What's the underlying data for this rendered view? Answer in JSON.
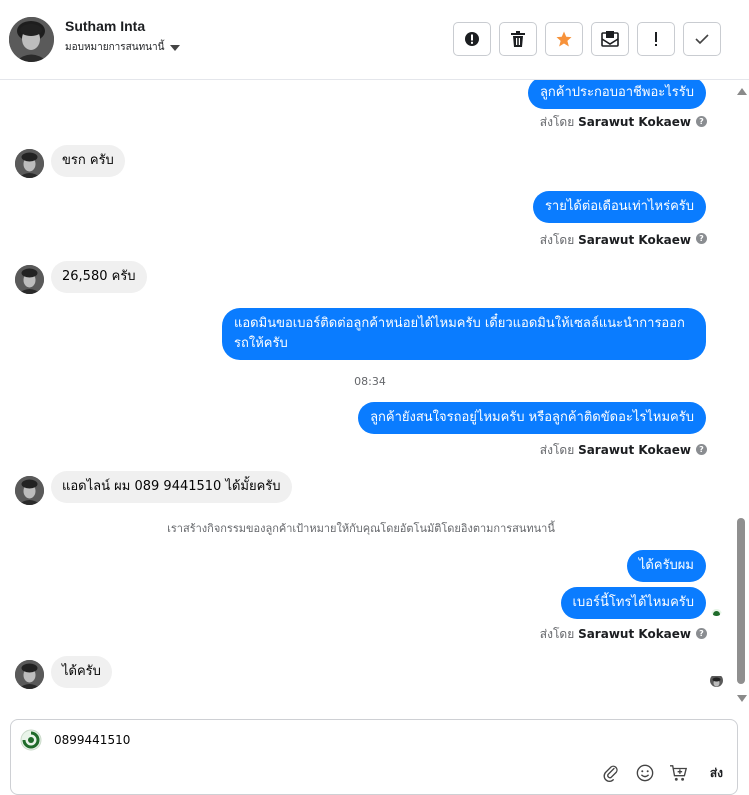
{
  "header": {
    "contact_name": "Sutham Inta",
    "assign_label": "มอบหมายการสนทนานี้",
    "toolbar": [
      {
        "icon": "alert-circle-icon",
        "label": "!"
      },
      {
        "icon": "trash-icon"
      },
      {
        "icon": "star-icon",
        "color": "#f7923a"
      },
      {
        "icon": "mail-icon"
      },
      {
        "icon": "exclamation-icon",
        "label": "!"
      },
      {
        "icon": "check-icon"
      }
    ]
  },
  "messages": {
    "m1": {
      "text": "ลูกค้าประกอบอาชีพอะไรรับ",
      "sender_prefix": "ส่งโดย",
      "sender": "Sarawut Kokaew"
    },
    "m2": {
      "text": "ขรก ครับ"
    },
    "m3": {
      "text": "รายได้ต่อเดือนเท่าไหร่ครับ",
      "sender_prefix": "ส่งโดย",
      "sender": "Sarawut Kokaew"
    },
    "m4": {
      "text": "26,580 ครับ"
    },
    "m5": {
      "text": "แอดมินขอเบอร์ติดต่อลูกค้าหน่อยได้ไหมครับ เดี๋ยวแอดมินให้เซลล์แนะนำการออกรถให้ครับ"
    },
    "time": "08:34",
    "m6": {
      "text": "ลูกค้ายังสนใจรถอยู่ไหมครับ หรือลูกค้าติดขัดอะไรไหมครับ",
      "sender_prefix": "ส่งโดย",
      "sender": "Sarawut Kokaew"
    },
    "m7": {
      "text": "แอดไลน์ ผม 089 9441510  ได้มั้ยครับ"
    },
    "system_note": "เราสร้างกิจกรรมของลูกค้าเป้าหมายให้กับคุณโดยอัตโนมัติโดยอิงตามการสนทนานี้",
    "m8": {
      "text": "ได้ครับผม"
    },
    "m9": {
      "text": "เบอร์นี้โทรได้ไหมครับ",
      "sender_prefix": "ส่งโดย",
      "sender": "Sarawut Kokaew"
    },
    "m10": {
      "text": "ได้ครับ"
    }
  },
  "composer": {
    "value": "0899441510",
    "send_label": "ส่ง",
    "tools": [
      "paperclip-icon",
      "emoji-icon",
      "cart-icon"
    ]
  },
  "colors": {
    "outgoing_bubble": "#0a7cff",
    "incoming_bubble": "#f0f0f0",
    "star": "#f7923a"
  }
}
